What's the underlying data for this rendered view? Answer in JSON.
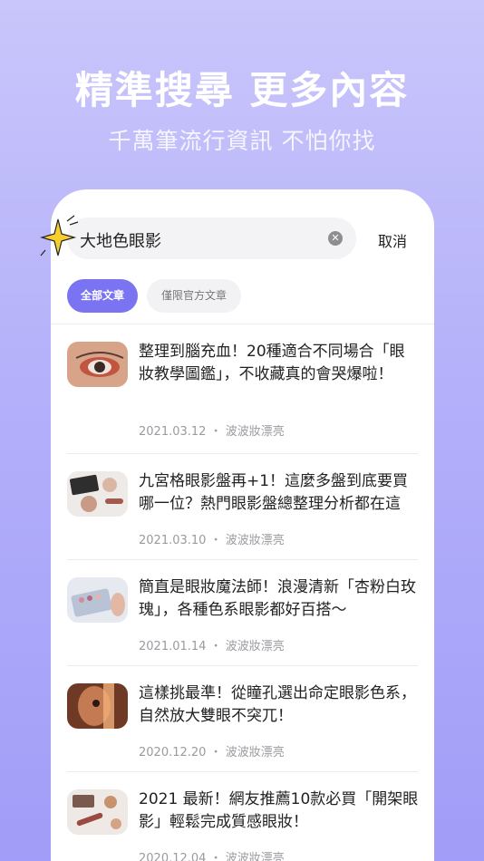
{
  "promo": {
    "headline": "精準搜尋 更多內容",
    "subline": "千萬筆流行資訊 不怕你找"
  },
  "search": {
    "query": "大地色眼影",
    "clear_icon": "close-circle-icon",
    "cancel_label": "取消"
  },
  "filters": [
    {
      "label": "全部文章",
      "active": true
    },
    {
      "label": "僅限官方文章",
      "active": false
    }
  ],
  "articles": [
    {
      "title": "整理到腦充血！20種適合不同場合「眼妝教學圖鑑」，不收藏真的會哭爆啦！",
      "date": "2021.03.12",
      "author": "波波妝漂亮",
      "thumb": "eye-makeup-closeup"
    },
    {
      "title": "九宮格眼影盤再+1！這麼多盤到底要買哪一位？熱門眼影盤總整理分析都在這",
      "date": "2021.03.10",
      "author": "波波妝漂亮",
      "thumb": "makeup-flatlay"
    },
    {
      "title": "簡直是眼妝魔法師！浪漫清新「杏粉白玫瑰」，各種色系眼影都好百搭～",
      "date": "2021.01.14",
      "author": "波波妝漂亮",
      "thumb": "eyeshadow-palette"
    },
    {
      "title": "這樣挑最準！從瞳孔選出命定眼影色系，自然放大雙眼不突兀！",
      "date": "2020.12.20",
      "author": "波波妝漂亮",
      "thumb": "eye-portrait"
    },
    {
      "title": "2021 最新！網友推薦10款必買「開架眼影」輕鬆完成質感眼妝！",
      "date": "2020.12.04",
      "author": "波波妝漂亮",
      "thumb": "cosmetics-flatlay"
    }
  ],
  "meta_separator": "・"
}
